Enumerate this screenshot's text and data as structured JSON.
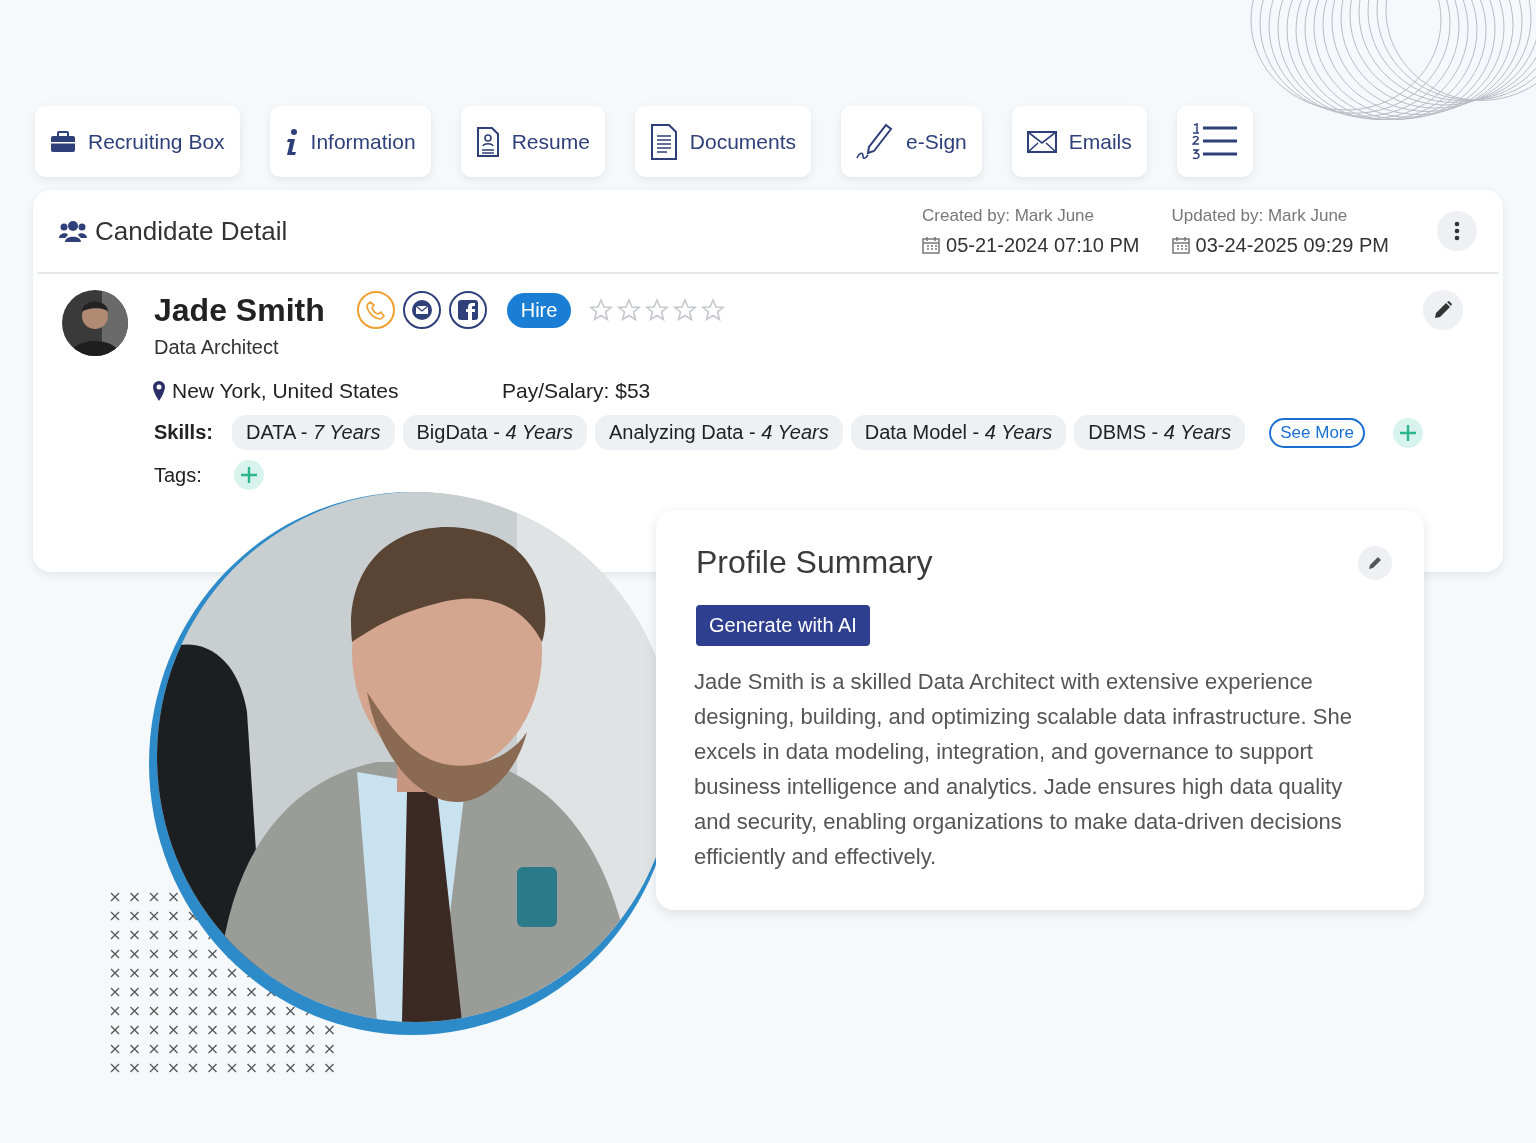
{
  "tabs": [
    {
      "kind": "briefcase",
      "label": "Recruiting Box"
    },
    {
      "kind": "info",
      "label": "Information"
    },
    {
      "kind": "resume",
      "label": "Resume"
    },
    {
      "kind": "documents",
      "label": "Documents"
    },
    {
      "kind": "esign",
      "label": "e-Sign"
    },
    {
      "kind": "emails",
      "label": "Emails"
    },
    {
      "kind": "list"
    }
  ],
  "card": {
    "title": "Candidate Detail",
    "created_by": "Created by: Mark June",
    "created_at": "05-21-2024 07:10 PM",
    "updated_by": "Updated by: Mark June",
    "updated_at": "03-24-2025 09:29 PM"
  },
  "candidate": {
    "name": "Jade Smith",
    "role": "Data Architect",
    "status": "Hire",
    "stars": 0,
    "location": "New York, United States",
    "pay": "Pay/Salary: $53",
    "skills_label": "Skills:",
    "skills": [
      "DATA - *7 Years*",
      "BigData - *4 Years*",
      "Analyzing Data - *4 Years*",
      "Data Model - *4 Years*",
      "DBMS - *4 Years*"
    ],
    "see_more": "See More",
    "tags_label": "Tags:"
  },
  "summary": {
    "title": "Profile Summary",
    "button": "Generate with AI",
    "text": "Jade Smith is a skilled Data Architect with extensive experience designing, building, and optimizing scalable data infrastructure. She excels in data modeling, integration, and governance to support business intelligence and analytics. Jade ensures high data quality and security, enabling organizations to make data-driven decisions efficiently and effectively."
  }
}
